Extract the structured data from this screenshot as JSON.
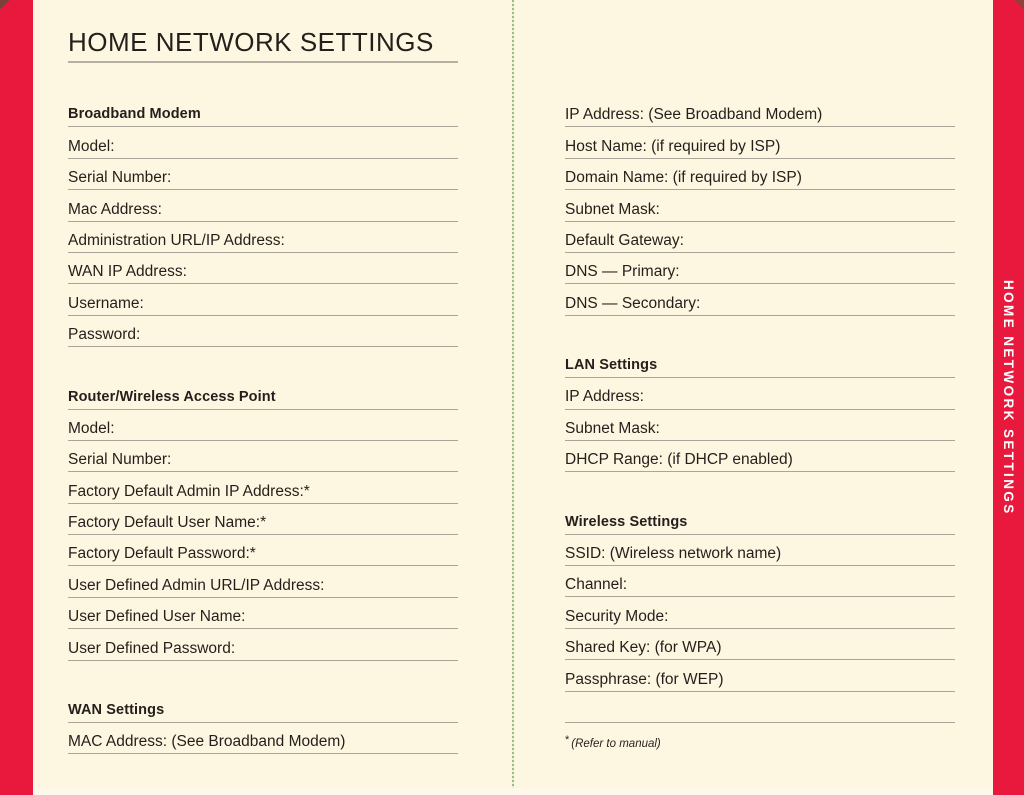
{
  "page": {
    "title": "HOME NETWORK SETTINGS",
    "tab_label": "HOME NETWORK SETTINGS",
    "colors": {
      "paper": "#fdf6e0",
      "band_red": "#e8193c",
      "rule": "#a9a699",
      "ink": "#241f1c",
      "spine_green": "#8fbf7e"
    }
  },
  "left_column": {
    "sections": [
      {
        "heading": "Broadband Modem",
        "fields": [
          "Model:",
          "Serial Number:",
          "Mac Address:",
          "Administration URL/IP Address:",
          "WAN IP Address:",
          "Username:",
          "Password:"
        ]
      },
      {
        "heading": "Router/Wireless Access Point",
        "fields": [
          "Model:",
          "Serial Number:",
          "Factory Default Admin IP Address:*",
          "Factory Default User Name:*",
          "Factory Default Password:*",
          "User Defined Admin URL/IP Address:",
          "User Defined User Name:",
          "User Defined Password:"
        ]
      },
      {
        "heading": "WAN Settings",
        "fields": [
          "MAC Address: (See Broadband Modem)"
        ]
      }
    ]
  },
  "right_column": {
    "sections": [
      {
        "heading": "",
        "fields": [
          "IP Address: (See Broadband Modem)",
          "Host Name: (if required by ISP)",
          "Domain Name: (if required by ISP)",
          "Subnet Mask:",
          "Default Gateway:",
          "DNS — Primary:",
          "DNS — Secondary:"
        ]
      },
      {
        "heading": "LAN Settings",
        "fields": [
          "IP Address:",
          "Subnet Mask:",
          "DHCP Range: (if DHCP enabled)"
        ]
      },
      {
        "heading": "Wireless Settings",
        "fields": [
          "SSID: (Wireless network name)",
          "Channel:",
          "Security Mode:",
          "Shared Key: (for WPA)",
          "Passphrase: (for WEP)",
          ""
        ]
      }
    ],
    "footnote_star": "*",
    "footnote": "(Refer to manual)"
  }
}
